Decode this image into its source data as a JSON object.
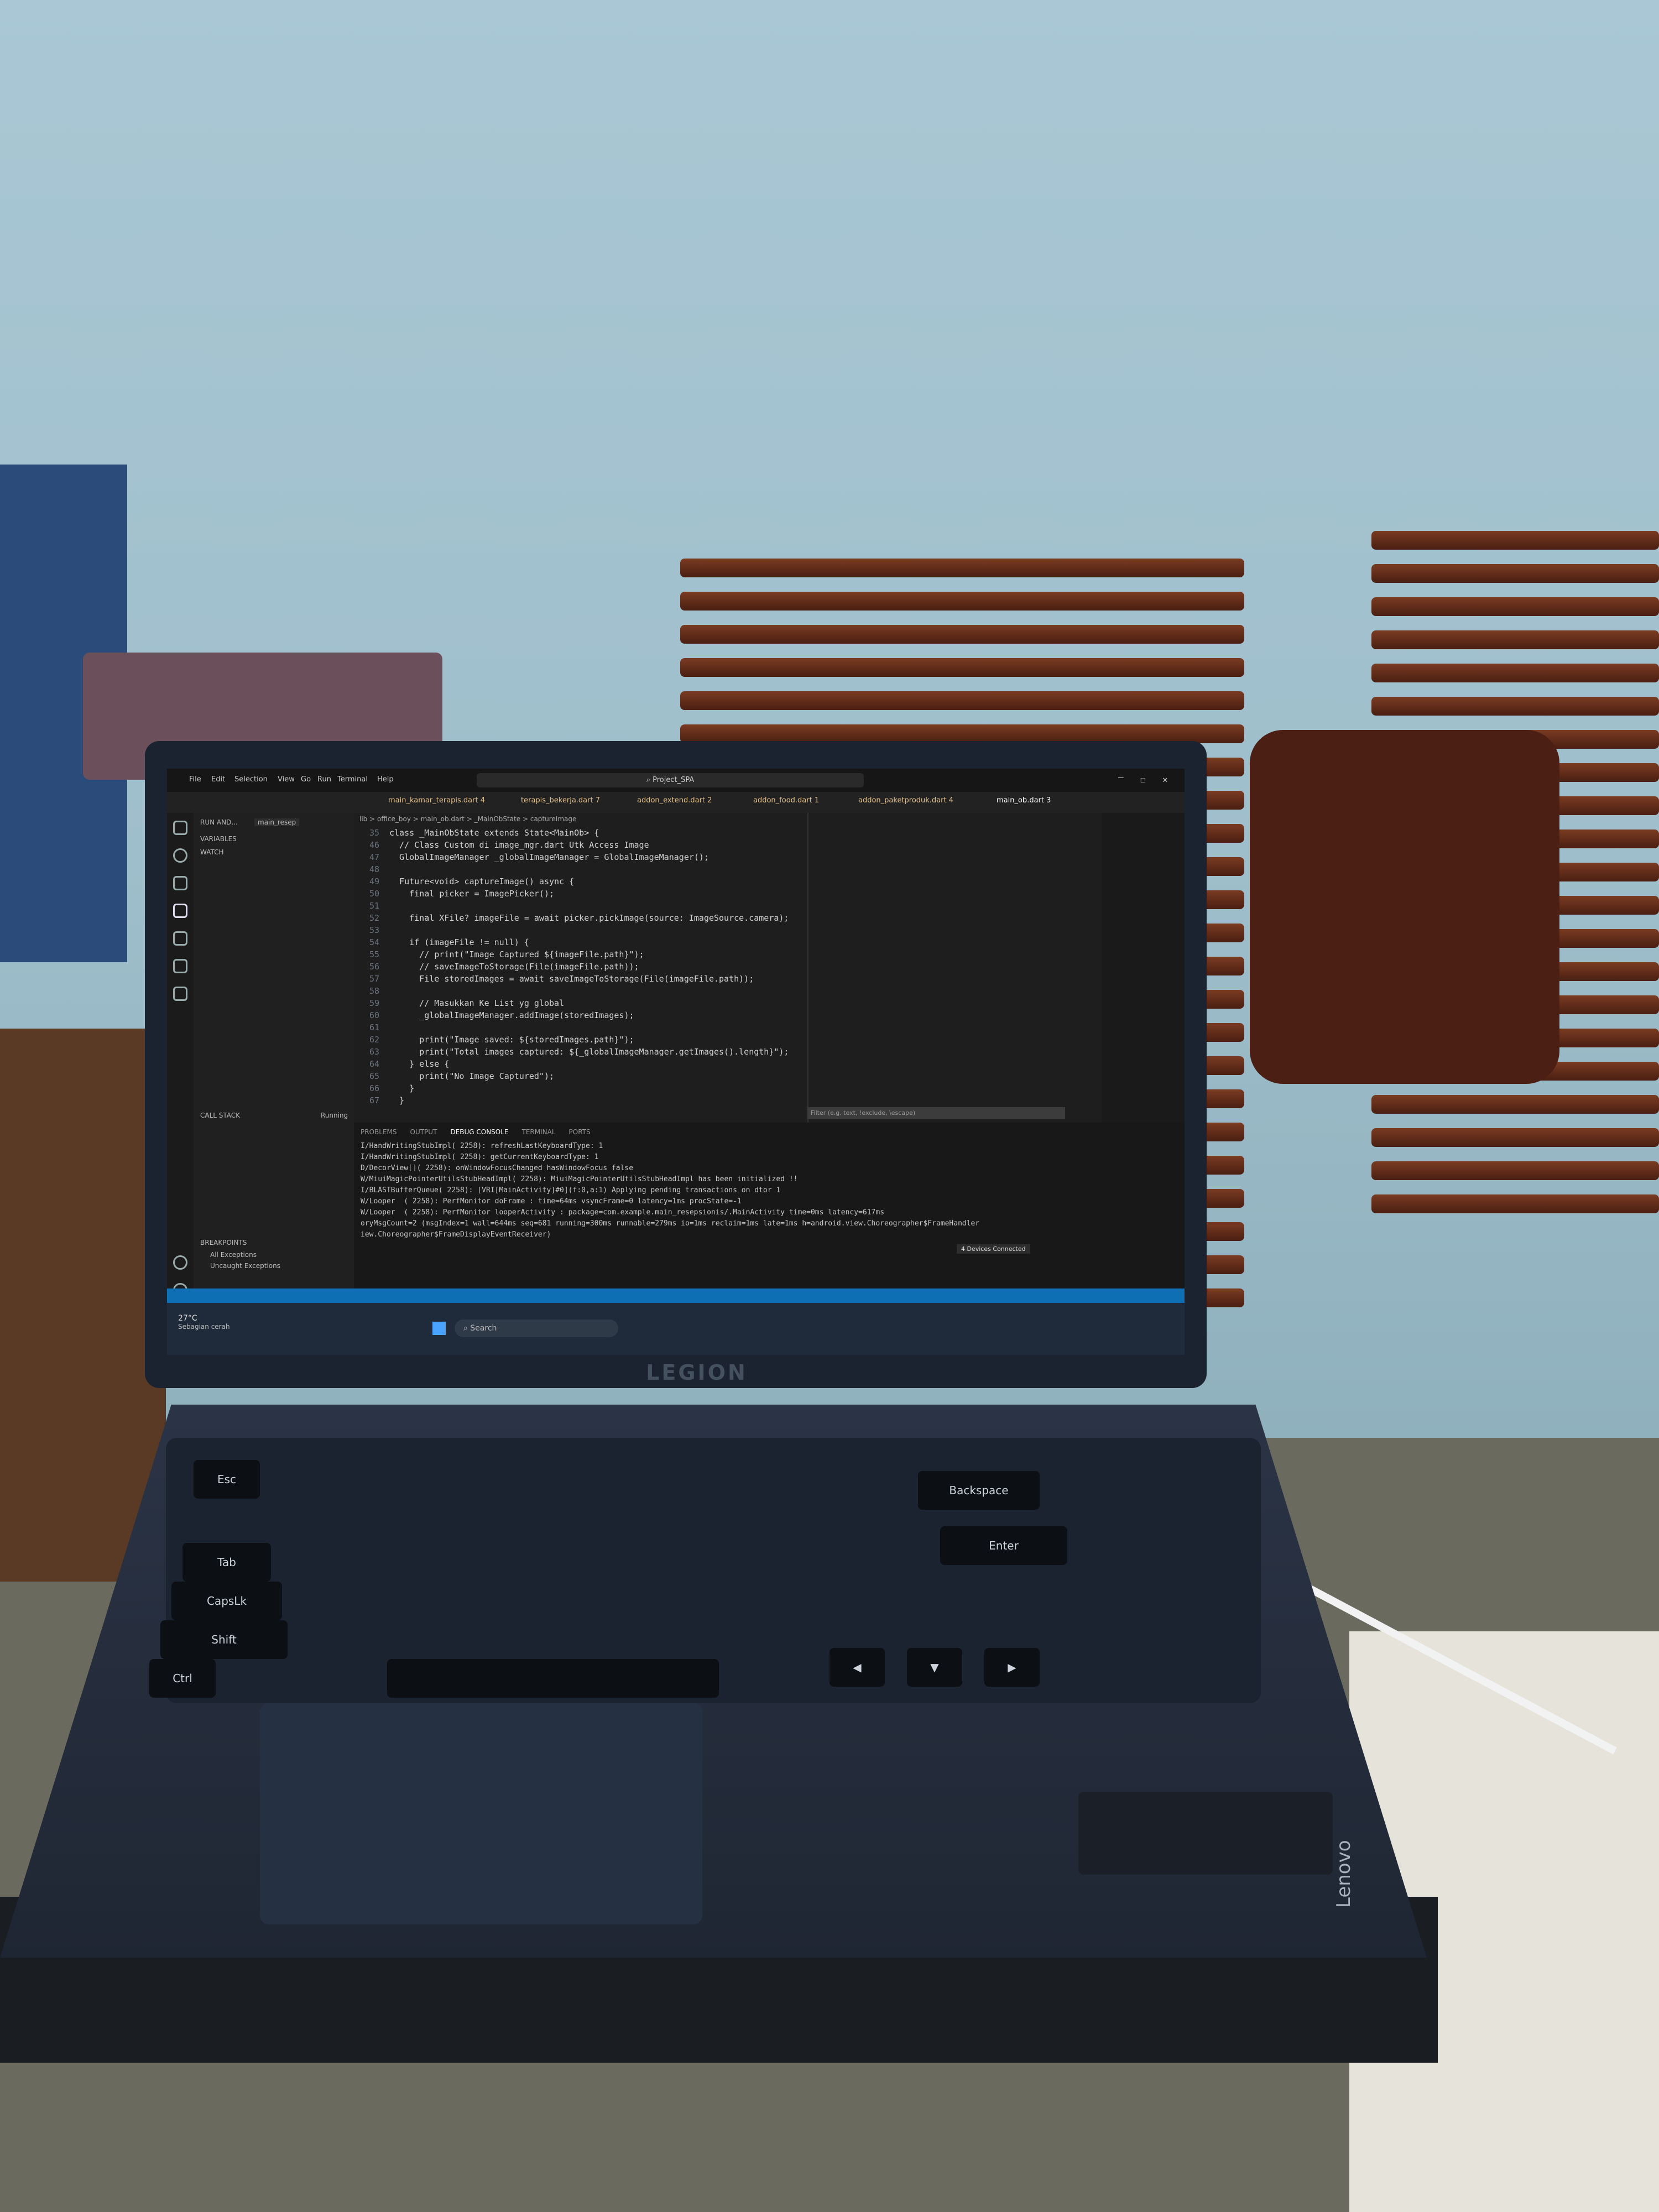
{
  "scene": {
    "brand_lid": "LEGION",
    "brand_base": "Lenovo"
  },
  "vscode": {
    "search_box": "Project_SPA",
    "menu": [
      "File",
      "Edit",
      "Selection",
      "View",
      "Go",
      "Run",
      "Terminal",
      "Help"
    ],
    "tabs": [
      "main_kamar_terapis.dart 4",
      "terapis_bekerja.dart 7",
      "addon_extend.dart 2",
      "addon_food.dart 1",
      "addon_paketproduk.dart 4",
      "main_ob.dart 3"
    ],
    "sidebar": {
      "run_label": "RUN AND...",
      "run_config": "main_resep",
      "variables": "VARIABLES",
      "watch": "WATCH",
      "call_stack": "CALL STACK",
      "call_stack_status": "Running",
      "breakpoints": "BREAKPOINTS",
      "bp_all": "All Exceptions",
      "bp_uncaught": "Uncaught Exceptions"
    },
    "breadcrumb": "lib > office_boy > main_ob.dart > _MainObState > captureImage",
    "code_lines": [
      {
        "n": "35",
        "t": "class _MainObState extends State<MainOb> {"
      },
      {
        "n": "46",
        "t": "  // Class Custom di image_mgr.dart Utk Access Image"
      },
      {
        "n": "47",
        "t": "  GlobalImageManager _globalImageManager = GlobalImageManager();"
      },
      {
        "n": "48",
        "t": ""
      },
      {
        "n": "49",
        "t": "  Future<void> captureImage() async {"
      },
      {
        "n": "50",
        "t": "    final picker = ImagePicker();"
      },
      {
        "n": "51",
        "t": ""
      },
      {
        "n": "52",
        "t": "    final XFile? imageFile = await picker.pickImage(source: ImageSource.camera);"
      },
      {
        "n": "53",
        "t": ""
      },
      {
        "n": "54",
        "t": "    if (imageFile != null) {"
      },
      {
        "n": "55",
        "t": "      // print(\"Image Captured ${imageFile.path}\");"
      },
      {
        "n": "56",
        "t": "      // saveImageToStorage(File(imageFile.path));"
      },
      {
        "n": "57",
        "t": "      File storedImages = await saveImageToStorage(File(imageFile.path));"
      },
      {
        "n": "58",
        "t": ""
      },
      {
        "n": "59",
        "t": "      // Masukkan Ke List yg global"
      },
      {
        "n": "60",
        "t": "      _globalImageManager.addImage(storedImages);"
      },
      {
        "n": "61",
        "t": ""
      },
      {
        "n": "62",
        "t": "      print(\"Image saved: ${storedImages.path}\");"
      },
      {
        "n": "63",
        "t": "      print(\"Total images captured: ${_globalImageManager.getImages().length}\");"
      },
      {
        "n": "64",
        "t": "    } else {"
      },
      {
        "n": "65",
        "t": "      print(\"No Image Captured\");"
      },
      {
        "n": "66",
        "t": "    }"
      },
      {
        "n": "67",
        "t": "  }"
      }
    ],
    "panel_tabs": [
      "PROBLEMS",
      "OUTPUT",
      "DEBUG CONSOLE",
      "TERMINAL",
      "PORTS"
    ],
    "filter_placeholder": "Filter (e.g. text, !exclude, \\escape)",
    "logs": [
      "I/HandWritingStubImpl( 2258): refreshLastKeyboardType: 1",
      "I/HandWritingStubImpl( 2258): getCurrentKeyboardType: 1",
      "D/DecorView[]( 2258): onWindowFocusChanged hasWindowFocus false",
      "W/MiuiMagicPointerUtilsStubHeadImpl( 2258): MiuiMagicPointerUtilsStubHeadImpl has been initialized !!",
      "I/BLASTBufferQueue( 2258): [VRI[MainActivity]#0](f:0,a:1) Applying pending transactions on dtor 1",
      "W/Looper  ( 2258): PerfMonitor doFrame : time=64ms vsyncFrame=0 latency=1ms procState=-1",
      "W/Looper  ( 2258): PerfMonitor looperActivity : package=com.example.main_resepsionis/.MainActivity time=0ms latency=617ms",
      "oryMsgCount=2 (msgIndex=1 wall=644ms seq=681 running=300ms runnable=279ms io=1ms reclaim=1ms late=1ms h=android.view.Choreographer$FrameHandler",
      "iew.Choreographer$FrameDisplayEventReceiver)"
    ],
    "devices_badge": "4 Devices Connected",
    "taskbar": {
      "weather_temp": "27°C",
      "weather_desc": "Sebagian cerah",
      "search": "Search"
    }
  }
}
